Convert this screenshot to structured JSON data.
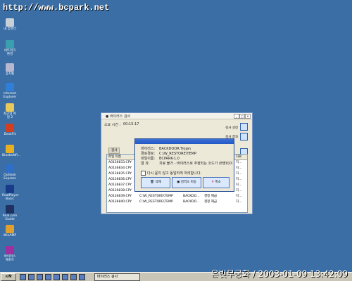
{
  "watermark": "http://www.bcpark.net",
  "desktop_icons": [
    {
      "label": "내 컴퓨터",
      "color": "#c8d0d8"
    },
    {
      "label": "네트워크 환경",
      "color": "#3aa0b0"
    },
    {
      "label": "휴지통",
      "color": "#b7b7d0"
    },
    {
      "label": "Internet Explorer",
      "color": "#2f7fd8"
    },
    {
      "label": "최근의 파일 2",
      "color": "#e8c85a"
    },
    {
      "label": "DeskFlt",
      "color": "#d04020"
    },
    {
      "label": "BluebeNfi...",
      "color": "#e8b020"
    },
    {
      "label": "Outlook Express",
      "color": "#2f6fc8"
    },
    {
      "label": "RealPlayer Basic",
      "color": "#1a3a8a"
    },
    {
      "label": "Real.com Guide",
      "color": "#203060"
    },
    {
      "label": "WinAMP",
      "color": "#e0a030"
    },
    {
      "label": "바이러스 재포트",
      "color": "#a030a0"
    }
  ],
  "window": {
    "title": "● 바이러스 검사",
    "elapsed_label": "소요 시간 :",
    "elapsed_value": "00:15:17",
    "side_buttons": [
      "검사 설정",
      "검사 결과"
    ],
    "tab_label": "검사",
    "table": {
      "header": [
        "파일 이름",
        "경로",
        "바이러스",
        "결과",
        "치료"
      ],
      "rows": [
        {
          "name": "A0136833.CPY",
          "path": "C:\\W_RESTORE\\TEMP",
          "virus": "BACKDO...",
          "result": "결정 제급",
          "action": "치..."
        },
        {
          "name": "A0136834.CPY",
          "path": "C:\\W_RESTORE\\TEMP",
          "virus": "BACKDO...",
          "result": "결정 제급",
          "action": "치..."
        },
        {
          "name": "A0136835.CPY",
          "path": "C:\\W_RESTORE\\TEMP",
          "virus": "BACKDO...",
          "result": "결정 제급",
          "action": "치..."
        },
        {
          "name": "A0136836.CPY",
          "path": "C:\\W_RESTORE\\TEMP",
          "virus": "BACKDO...",
          "result": "결정 제급",
          "action": "치..."
        },
        {
          "name": "A0136837.CPY",
          "path": "C:\\W_RESTORE\\TEMP",
          "virus": "BACKDO...",
          "result": "결정 제급",
          "action": "치..."
        },
        {
          "name": "A0136838.CPY",
          "path": "C:\\W_RESTORE\\TEMP",
          "virus": "BACKDO...",
          "result": "결정 제급",
          "action": "치..."
        },
        {
          "name": "A0136839.CPY",
          "path": "C:\\W_RESTORE\\TEMP",
          "virus": "BACKDO...",
          "result": "결정 제급",
          "action": "치..."
        },
        {
          "name": "A0136840.CPY",
          "path": "C:\\W_RESTORE\\TEMP",
          "virus": "BACKDO...",
          "result": "결정 제급",
          "action": "치..."
        }
      ]
    }
  },
  "dialog": {
    "virus_label": "바이러스:",
    "virus_value": "BACKDOOR.Trojan",
    "path_label": "경로경로:",
    "path_value": "C:\\W_RESTORE\\TEMP",
    "file_label": "파일이름:",
    "file_value": "BCPARK-1.0",
    "result_label": "결 과:",
    "result_value": "치료 불가 - 바이러스로 추정되는 코드가 (8명0)이 있습니다.",
    "checkbox_label": "다시 묻지 않고 동일하게 처리합니다.",
    "buttons": [
      "삭제",
      "검역소 이동",
      "취소"
    ]
  },
  "taskbar": {
    "start_label": "시작",
    "task_label": "바이러스 검사"
  },
  "clock_text": "은빛무궁화 / 2003-01-09 13:42:09"
}
